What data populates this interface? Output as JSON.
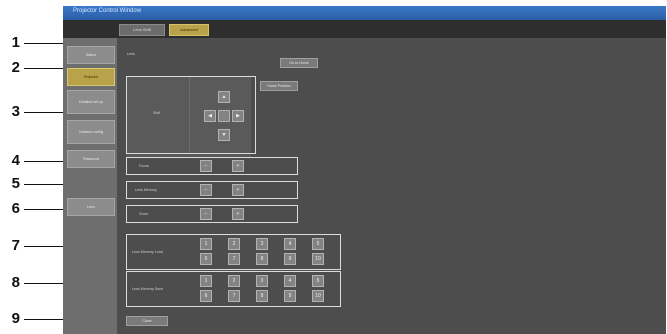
{
  "window": {
    "title": "Projector Control Window"
  },
  "top_tabs": [
    "Lens Shift",
    "Advanced"
  ],
  "sidebar": [
    {
      "label": "Status"
    },
    {
      "label": "Projector"
    },
    {
      "label": "Detailed set up"
    },
    {
      "label": "Network config"
    },
    {
      "label": "Password"
    },
    {
      "label": "Lens"
    }
  ],
  "callouts": [
    "1",
    "2",
    "3",
    "4",
    "5",
    "6",
    "7",
    "8",
    "9"
  ],
  "main": {
    "header_label": "Lens",
    "top_button": "Go to Home",
    "second_button": "Home Position",
    "shift": {
      "label": "Shift",
      "up": "▲",
      "left": "◀",
      "right": "▶",
      "down": "▼"
    },
    "focus": {
      "label": "Focus",
      "minus": "−",
      "plus": "+"
    },
    "zoom": {
      "label": "Zoom",
      "minus": "−",
      "plus": "+"
    },
    "other": {
      "label": "Lens Memory",
      "minus": "−",
      "plus": "+"
    },
    "row7_label": "Lens Memory Load",
    "row8_label": "Lens Memory Save",
    "grid_cells": [
      "1",
      "2",
      "3",
      "4",
      "5",
      "6",
      "7",
      "8",
      "9",
      "10"
    ],
    "close_button": "Close"
  }
}
